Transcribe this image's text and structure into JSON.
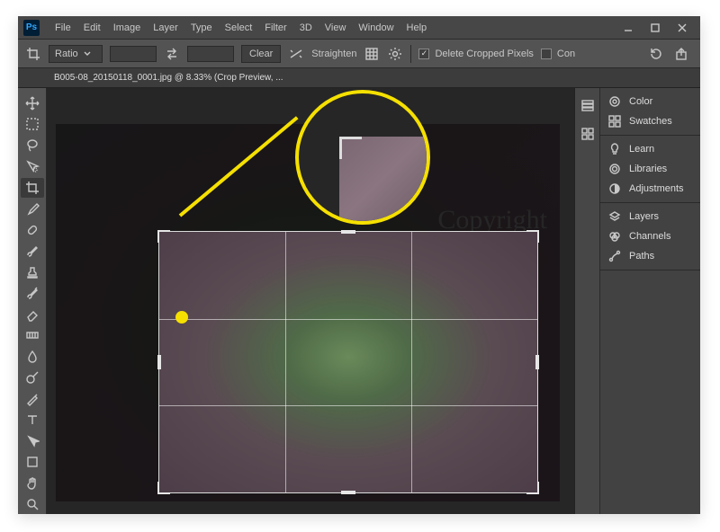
{
  "menubar": [
    "File",
    "Edit",
    "Image",
    "Layer",
    "Type",
    "Select",
    "Filter",
    "3D",
    "View",
    "Window",
    "Help"
  ],
  "optionsBar": {
    "ratioLabel": "Ratio",
    "clearLabel": "Clear",
    "straightenLabel": "Straighten",
    "deleteCroppedLabel": "Delete Cropped Pixels",
    "contentAwareLabel": "Con"
  },
  "tab": {
    "title": "B005-08_20150118_0001.jpg @ 8.33% (Crop Preview, ..."
  },
  "overlay": {
    "copyright": "Copyright"
  },
  "panels": {
    "group1": [
      "Color",
      "Swatches"
    ],
    "group2": [
      "Learn",
      "Libraries",
      "Adjustments"
    ],
    "group3": [
      "Layers",
      "Channels",
      "Paths"
    ]
  },
  "colors": {
    "accentYellow": "#f5e000"
  }
}
